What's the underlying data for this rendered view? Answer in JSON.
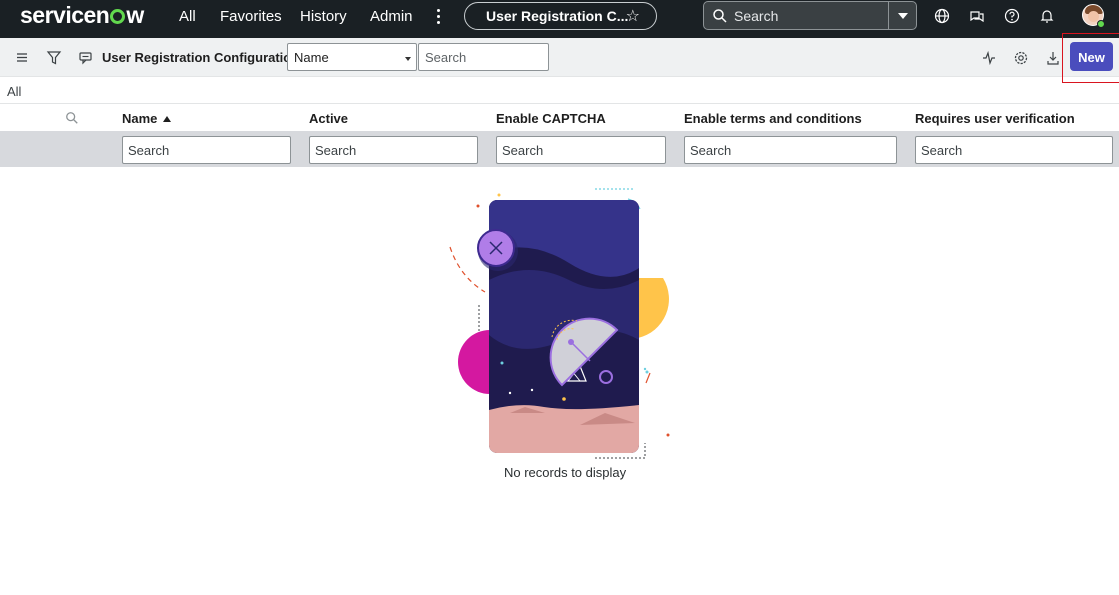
{
  "topnav": {
    "logo": "servicenow",
    "links": [
      "All",
      "Favorites",
      "History",
      "Admin"
    ],
    "context_pill": "User Registration C...",
    "search_placeholder": "Search"
  },
  "listbar": {
    "title": "User Registration Configurations",
    "field_select": "Name",
    "search_placeholder": "Search",
    "new_label": "New"
  },
  "breadcrumb": "All",
  "table": {
    "columns": [
      "Name",
      "Active",
      "Enable CAPTCHA",
      "Enable terms and conditions",
      "Requires user verification"
    ],
    "sort_column": "Name",
    "sort_direction": "ascending",
    "filter_placeholder": "Search"
  },
  "empty_state": {
    "message": "No records to display"
  },
  "colors": {
    "nav_bg": "#1a2024",
    "accent": "#4a4dbd",
    "highlight": "#d9141f"
  }
}
